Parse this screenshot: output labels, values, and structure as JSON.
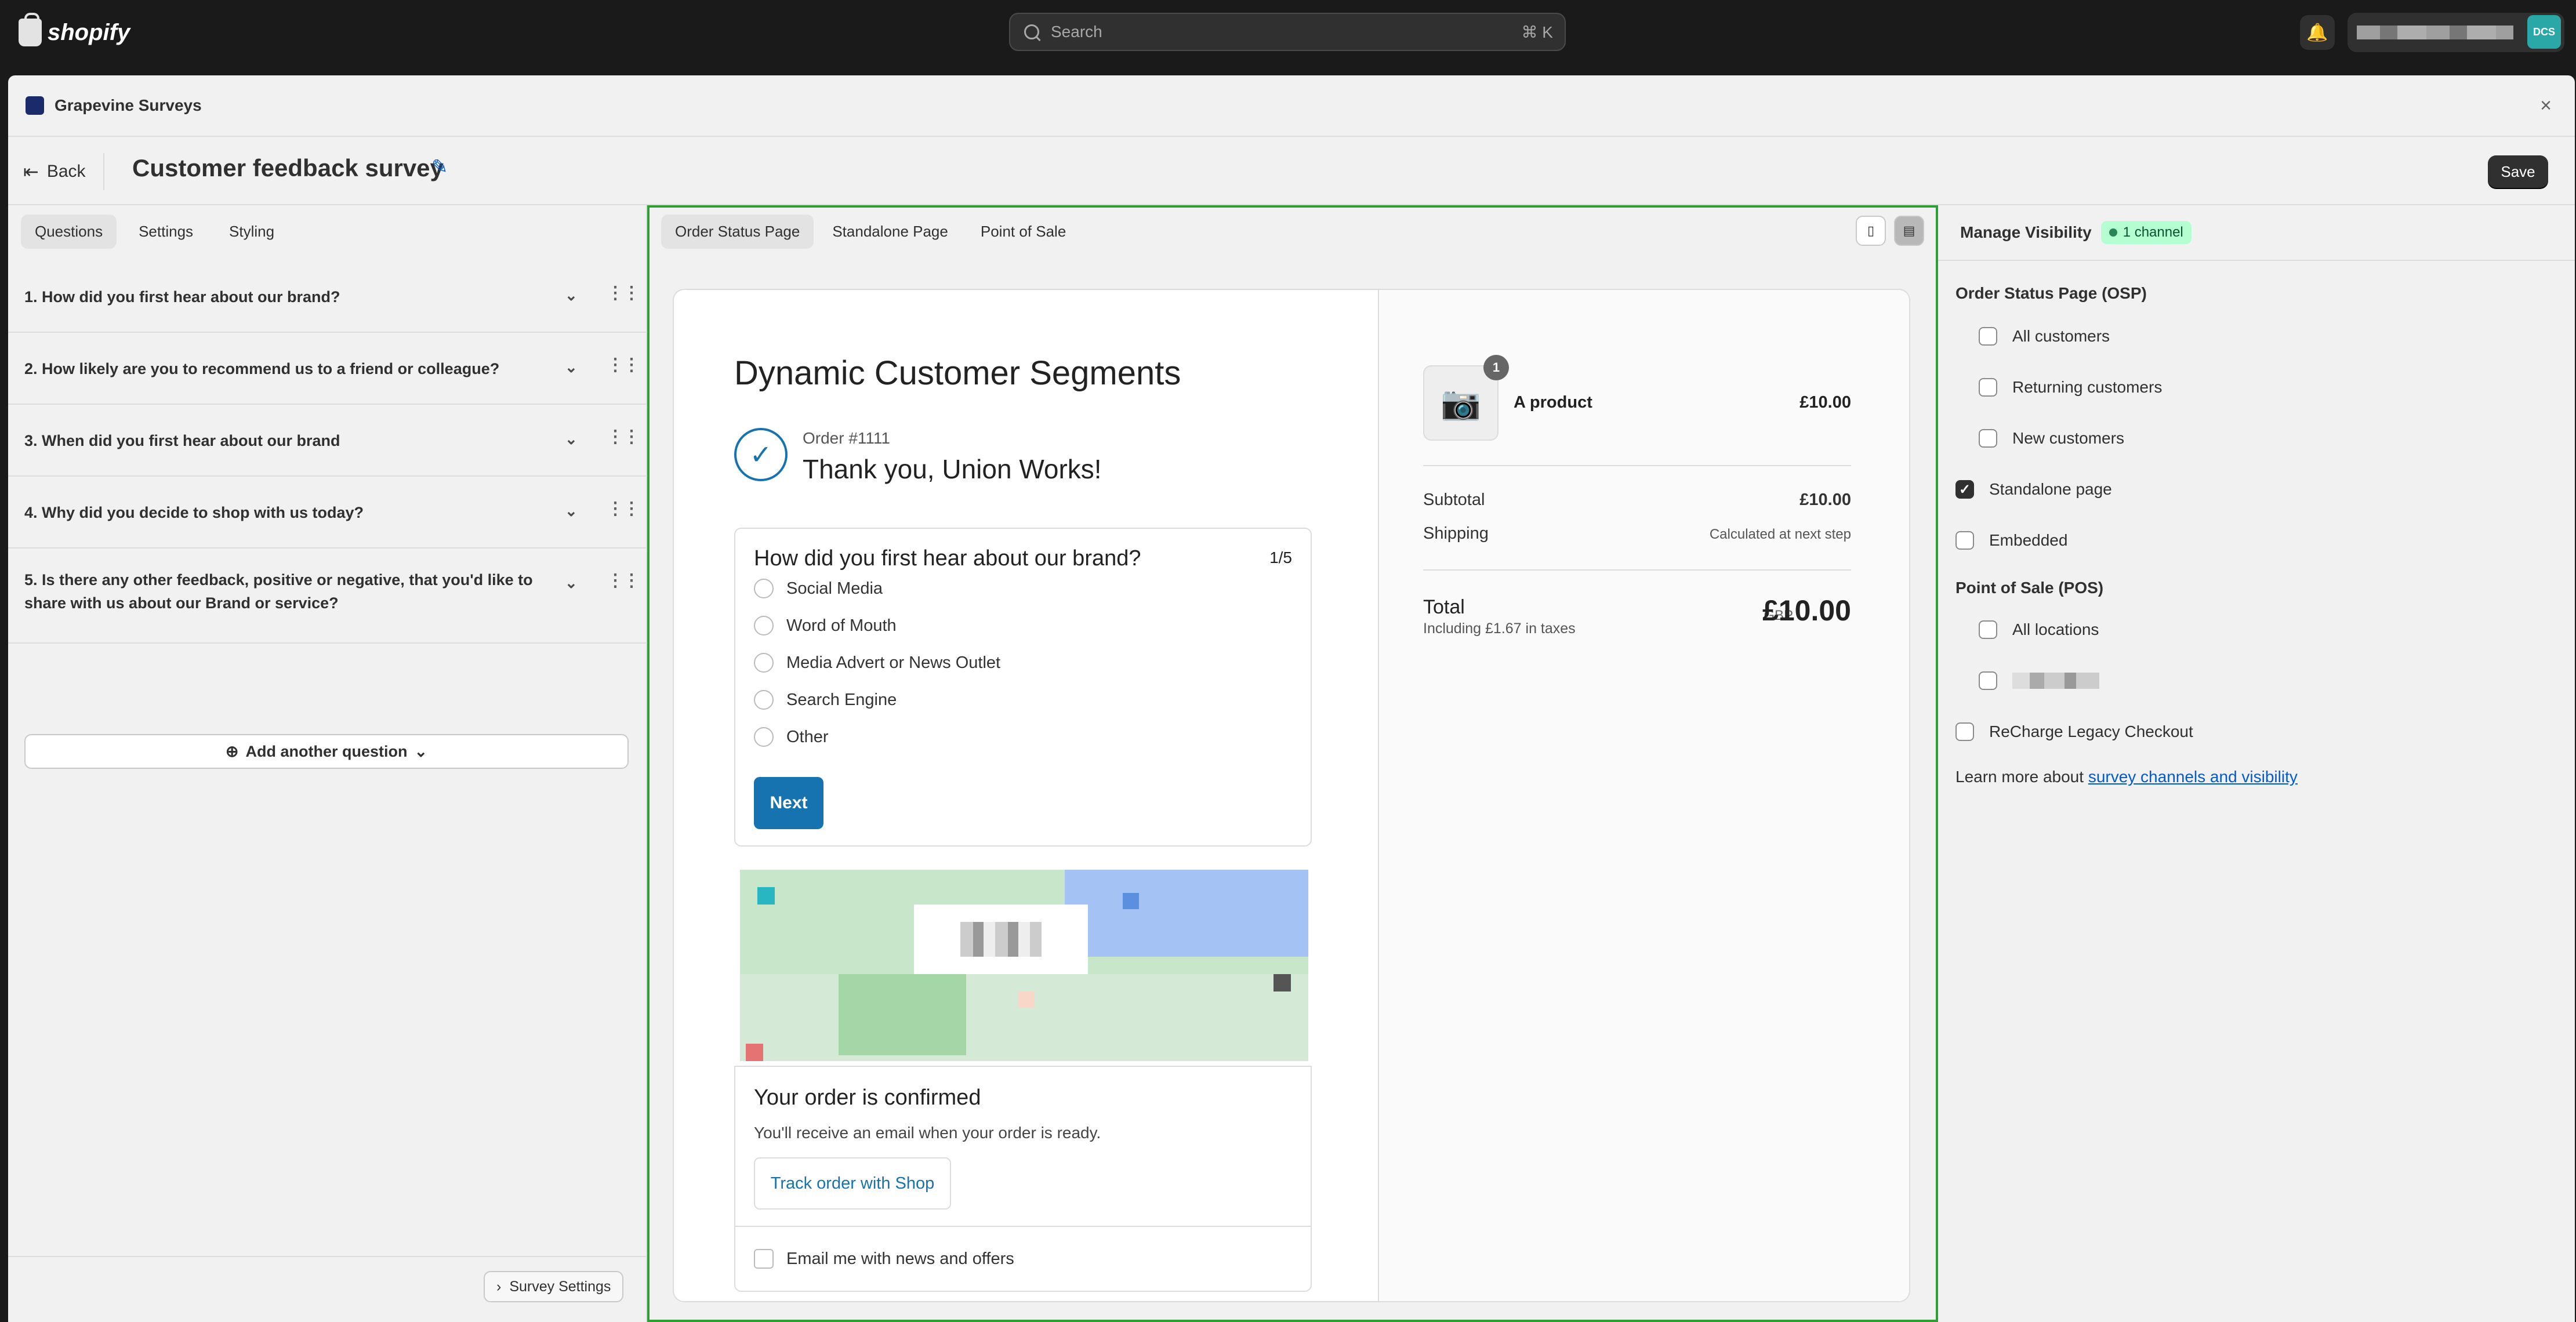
{
  "topbar": {
    "logo_text": "shopify",
    "search_placeholder": "Search",
    "search_shortcut": "⌘ K",
    "avatar_initials": "DCS"
  },
  "app": {
    "name": "Grapevine Surveys",
    "close": "×",
    "back_label": "Back",
    "title": "Customer feedback survey",
    "save_label": "Save"
  },
  "left": {
    "tabs": [
      {
        "label": "Questions",
        "active": true
      },
      {
        "label": "Settings",
        "active": false
      },
      {
        "label": "Styling",
        "active": false
      }
    ],
    "questions": [
      "1. How did you first hear about our brand?",
      "2. How likely are you to recommend us to a friend or colleague?",
      "3. When did you first hear about our brand",
      "4. Why did you decide to shop with us today?",
      "5. Is there any other feedback, positive or negative, that you'd like to share with us about our Brand or service?"
    ],
    "add_question_label": "Add another question",
    "survey_settings_label": "Survey Settings"
  },
  "preview": {
    "tabs": [
      {
        "label": "Order Status Page",
        "active": true
      },
      {
        "label": "Standalone Page",
        "active": false
      },
      {
        "label": "Point of Sale",
        "active": false
      }
    ],
    "shop_name": "Dynamic Customer Segments",
    "order_number": "Order #1111",
    "thanks": "Thank you, Union Works!",
    "survey": {
      "question": "How did you first hear about our brand?",
      "counter": "1/5",
      "options": [
        "Social Media",
        "Word of Mouth",
        "Media Advert or News Outlet",
        "Search Engine",
        "Other"
      ],
      "next_label": "Next"
    },
    "confirmation": {
      "title": "Your order is confirmed",
      "subtitle": "You'll receive an email when your order is ready.",
      "track_label": "Track order with Shop",
      "email_opt_in": "Email me with news and offers"
    },
    "summary": {
      "quantity": "1",
      "product_name": "A product",
      "product_price": "£10.00",
      "subtotal_label": "Subtotal",
      "subtotal_value": "£10.00",
      "shipping_label": "Shipping",
      "shipping_value": "Calculated at next step",
      "total_label": "Total",
      "tax_note": "Including £1.67 in taxes",
      "currency": "GBP",
      "total_value": "£10.00"
    }
  },
  "visibility": {
    "title": "Manage Visibility",
    "badge": "1 channel",
    "osp_title": "Order Status Page (OSP)",
    "osp_options": [
      {
        "label": "All customers",
        "checked": false
      },
      {
        "label": "Returning customers",
        "checked": false
      },
      {
        "label": "New customers",
        "checked": false
      }
    ],
    "standalone": {
      "label": "Standalone page",
      "checked": true
    },
    "embedded": {
      "label": "Embedded",
      "checked": false
    },
    "pos_title": "Point of Sale (POS)",
    "pos_all": {
      "label": "All locations",
      "checked": false
    },
    "recharge": {
      "label": "ReCharge Legacy Checkout",
      "checked": false
    },
    "learn_prefix": "Learn more about ",
    "learn_link": "survey channels and visibility"
  }
}
